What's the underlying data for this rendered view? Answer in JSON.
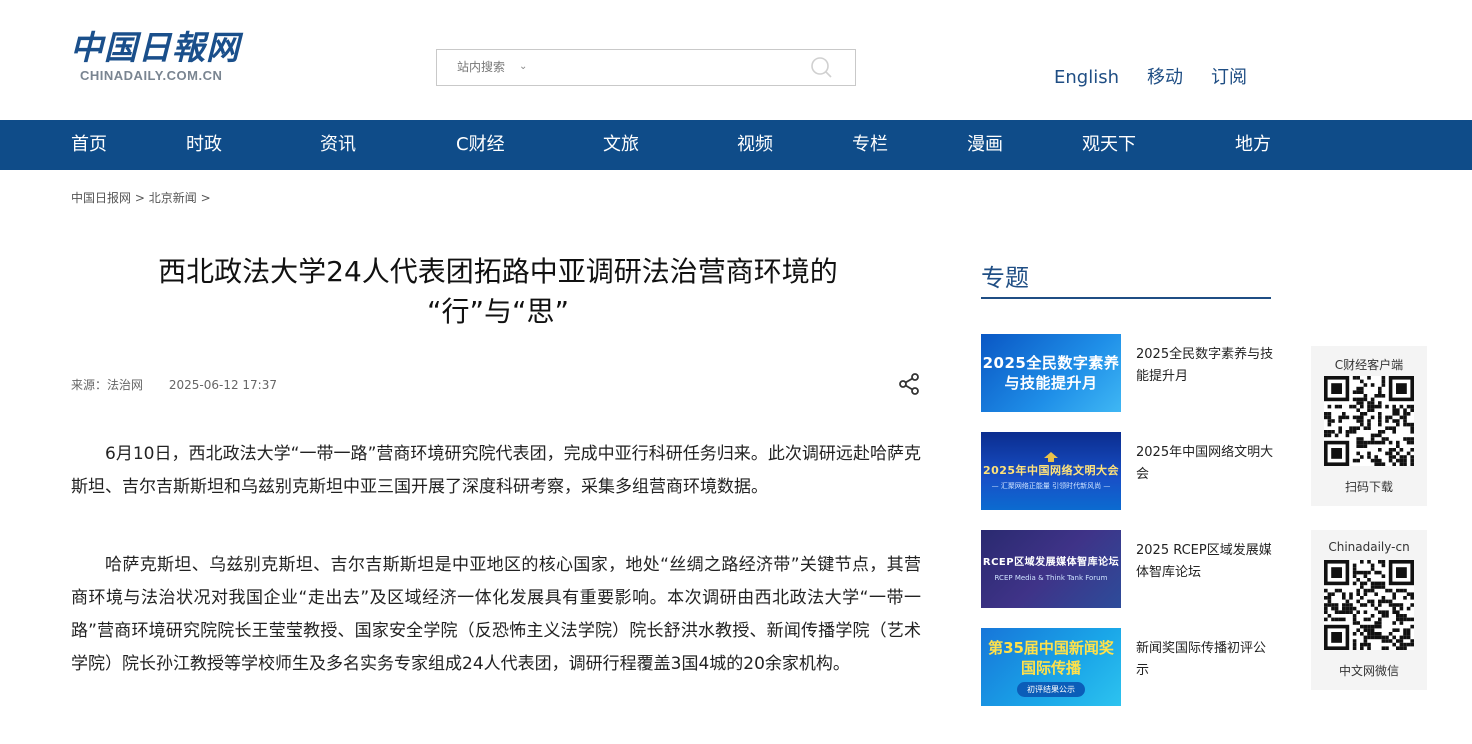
{
  "header": {
    "logo_cn": "中国日報网",
    "logo_en": "CHINADAILY.COM.CN",
    "search_scope": "站内搜索",
    "search_placeholder": "",
    "links": [
      "English",
      "移动",
      "订阅"
    ]
  },
  "nav": {
    "items": [
      "首页",
      "时政",
      "资讯",
      "C财经",
      "文旅",
      "视频",
      "专栏",
      "漫画",
      "观天下",
      "地方"
    ]
  },
  "breadcrumb": {
    "items": [
      "中国日报网",
      "北京新闻"
    ],
    "separator": ">"
  },
  "article": {
    "title_line1": "西北政法大学24人代表团拓路中亚调研法治营商环境的",
    "title_line2": "“行”与“思”",
    "source": "来源：法治网",
    "date": "2025-06-12 17:37",
    "paragraphs": [
      "6月10日，西北政法大学“一带一路”营商环境研究院代表团，完成中亚行科研任务归来。此次调研远赴哈萨克斯坦、吉尔吉斯斯坦和乌兹别克斯坦中亚三国开展了深度科研考察，采集多组营商环境数据。",
      "哈萨克斯坦、乌兹别克斯坦、吉尔吉斯斯坦是中亚地区的核心国家，地处“丝绸之路经济带”关键节点，其营商环境与法治状况对我国企业“走出去”及区域经济一体化发展具有重要影响。本次调研由西北政法大学“一带一路”营商环境研究院院长王莹莹教授、国家安全学院（反恐怖主义法学院）院长舒洪水教授、新闻传播学院（艺术学院）院长孙江教授等学校师生及多名实务专家组成24人代表团，调研行程覆盖3国4城的20余家机构。"
    ]
  },
  "topics": {
    "heading": "专题",
    "items": [
      {
        "label": "2025全民数字素养与技能提升月",
        "thumb_line1": "2025全民数字素养",
        "thumb_line2": "与技能提升月"
      },
      {
        "label": "2025年中国网络文明大会",
        "thumb_line1": "2025年中国网络文明大会",
        "thumb_line2": "— 汇聚网络正能量 引领时代新风尚 —"
      },
      {
        "label": "2025 RCEP区域发展媒体智库论坛",
        "thumb_line1": "RCEP区域发展媒体智库论坛",
        "thumb_line2": "RCEP Media & Think Tank Forum"
      },
      {
        "label": "新闻奖国际传播初评公示",
        "thumb_line1": "第35届中国新闻奖",
        "thumb_line2": "国际传播",
        "thumb_pill": "初评结果公示"
      }
    ]
  },
  "qr_cards": [
    {
      "title": "C财经客户端",
      "caption": "扫码下载"
    },
    {
      "title": "Chinadaily-cn",
      "caption": "中文网微信"
    }
  ],
  "colors": {
    "nav_bg": "#0f4c89",
    "brand_blue": "#1f4e84",
    "qr_bg": "#f4f4f4"
  }
}
